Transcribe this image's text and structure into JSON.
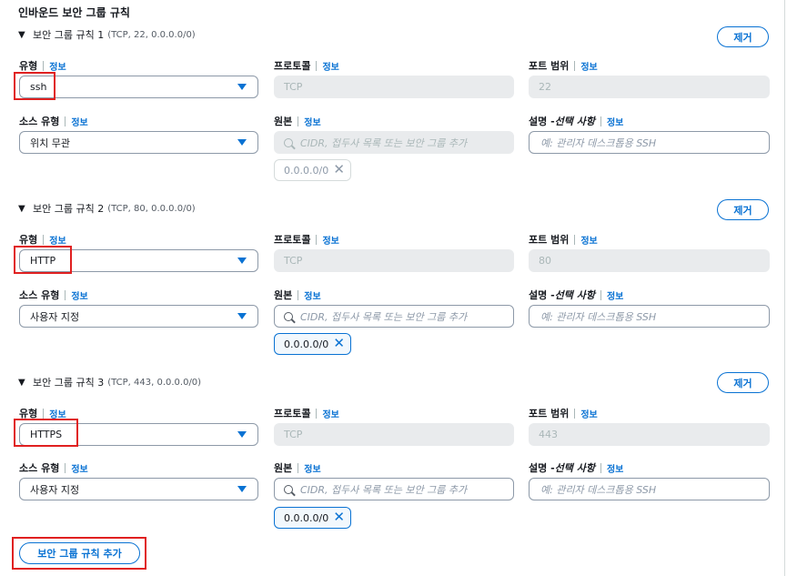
{
  "section_title": "인바운드 보안 그룹 규칙",
  "labels": {
    "type": "유형",
    "protocol": "프로토콜",
    "port_range": "포트 범위",
    "source_type": "소스 유형",
    "source": "원본",
    "description_main": "설명 - ",
    "description_optional": "선택 사항",
    "info": "정보"
  },
  "remove_label": "제거",
  "source_placeholder": "CIDR, 접두사 목록 또는 보안 그룹 추가",
  "description_placeholder": "예: 관리자 데스크톱용 SSH",
  "rules": [
    {
      "title": "보안 그룹 규칙 1",
      "summary": "(TCP, 22, 0.0.0.0/0)",
      "type": "ssh",
      "protocol": "TCP",
      "port_range": "22",
      "source_type": "위치 무관",
      "source_token": "0.0.0.0/0",
      "source_editable": false
    },
    {
      "title": "보안 그룹 규칙 2",
      "summary": "(TCP, 80, 0.0.0.0/0)",
      "type": "HTTP",
      "protocol": "TCP",
      "port_range": "80",
      "source_type": "사용자 지정",
      "source_token": "0.0.0.0/0",
      "source_editable": true
    },
    {
      "title": "보안 그룹 규칙 3",
      "summary": "(TCP, 443, 0.0.0.0/0)",
      "type": "HTTPS",
      "protocol": "TCP",
      "port_range": "443",
      "source_type": "사용자 지정",
      "source_token": "0.0.0.0/0",
      "source_editable": true
    }
  ],
  "add_rule_label": "보안 그룹 규칙 추가",
  "colors": {
    "accent": "#0972d3",
    "highlight": "#e02020",
    "disabled_bg": "#e9ebed"
  },
  "icons": {
    "expand": "caret-down-icon",
    "dropdown": "dropdown-caret-icon",
    "search": "search-icon",
    "remove_token": "close-icon"
  }
}
